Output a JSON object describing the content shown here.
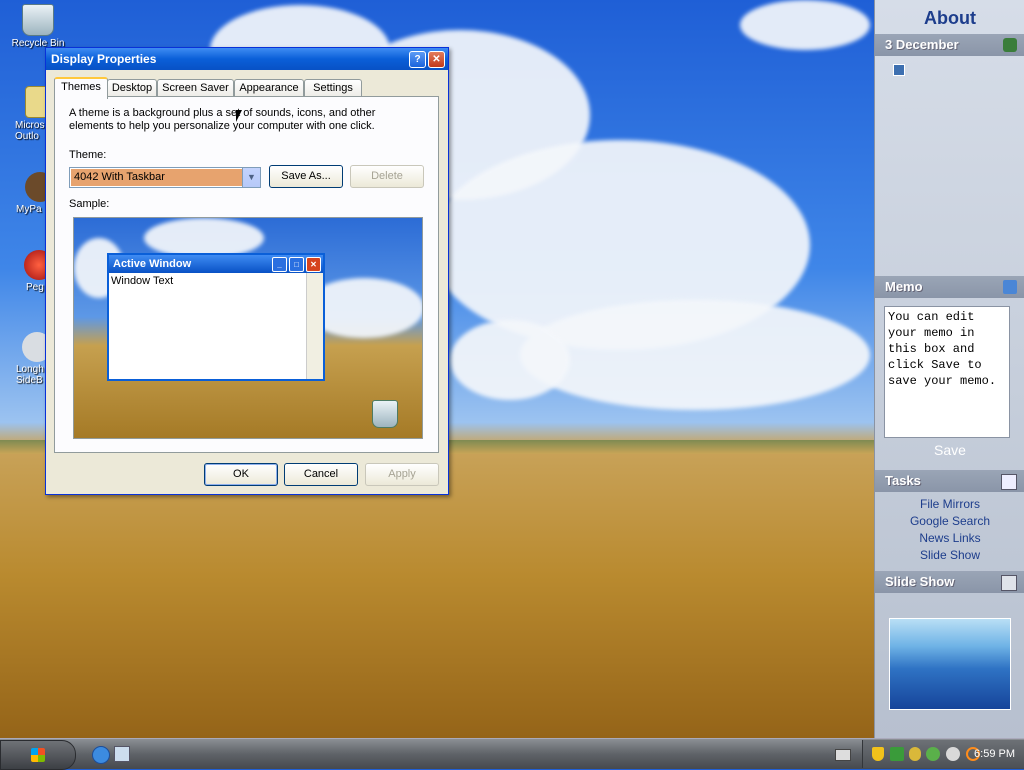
{
  "desktop": {
    "icons": [
      {
        "label": "Recycle Bin"
      },
      {
        "label": "Micros Outlo"
      },
      {
        "label": "MyPa"
      },
      {
        "label": "Peg"
      },
      {
        "label": "Longh SideB"
      }
    ]
  },
  "dialog": {
    "title": "Display Properties",
    "help_glyph": "?",
    "close_glyph": "✕",
    "tabs": [
      "Themes",
      "Desktop",
      "Screen Saver",
      "Appearance",
      "Settings"
    ],
    "description": "A theme is a background plus a set of sounds, icons, and other elements to help you personalize your computer with one click.",
    "theme_label": "Theme:",
    "theme_value": "4042 With Taskbar",
    "save_as_label": "Save As...",
    "delete_label": "Delete",
    "sample_label": "Sample:",
    "sample_window_title": "Active Window",
    "sample_window_text": "Window Text",
    "ok_label": "OK",
    "cancel_label": "Cancel",
    "apply_label": "Apply"
  },
  "sidebar": {
    "about": "About",
    "date": "3 December",
    "memo_header": "Memo",
    "memo_text": "You can edit your memo in this box and click Save to save your memo.",
    "save_label": "Save",
    "tasks_header": "Tasks",
    "tasks": [
      "File Mirrors",
      "Google Search",
      "News Links",
      "Slide Show"
    ],
    "slideshow_header": "Slide Show"
  },
  "taskbar": {
    "clock": "6:59 PM"
  },
  "colors": {
    "titlebar_blue": "#0a5fd8",
    "dialog_bg": "#ece9d8",
    "selection_orange": "#e7a36e"
  }
}
